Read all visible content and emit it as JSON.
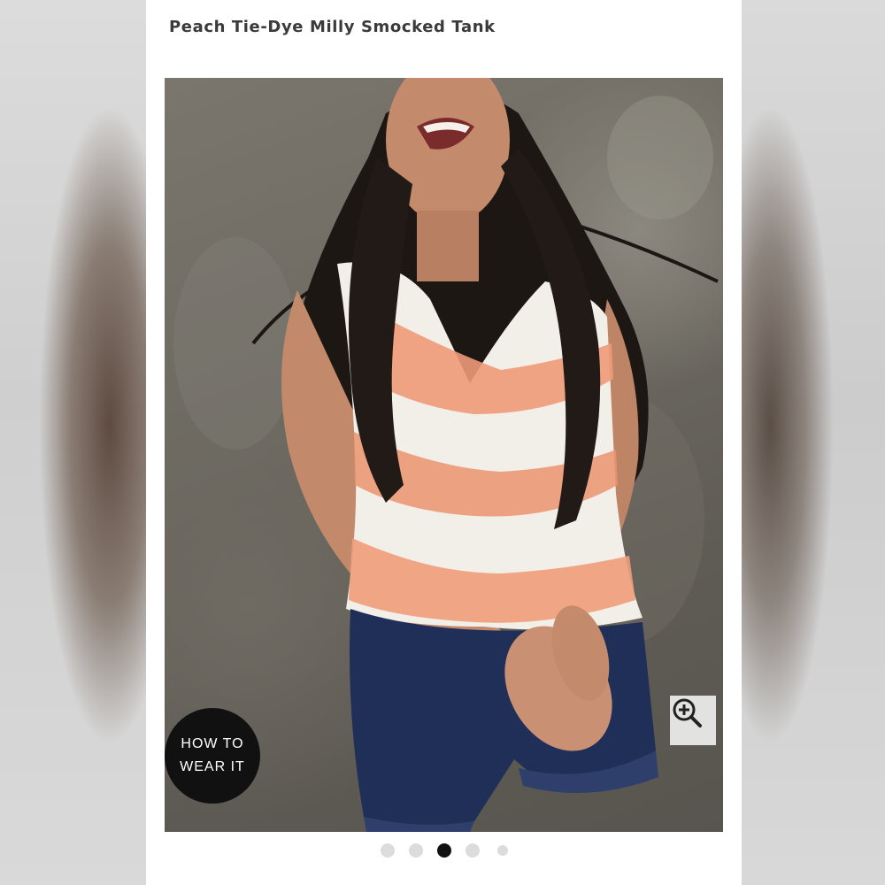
{
  "product": {
    "title": "Peach Tie-Dye Milly Smocked Tank"
  },
  "badge": {
    "line1": "HOW TO",
    "line2": "WEAR IT"
  },
  "zoom": {
    "icon": "zoom-in-icon"
  },
  "gallery": {
    "image_count": 5,
    "active_index": 3
  },
  "colors": {
    "badge_bg": "#111111",
    "active_dot": "#111111",
    "inactive_dot": "#dcdcdc",
    "shirt_peach": "#ee9a78"
  }
}
